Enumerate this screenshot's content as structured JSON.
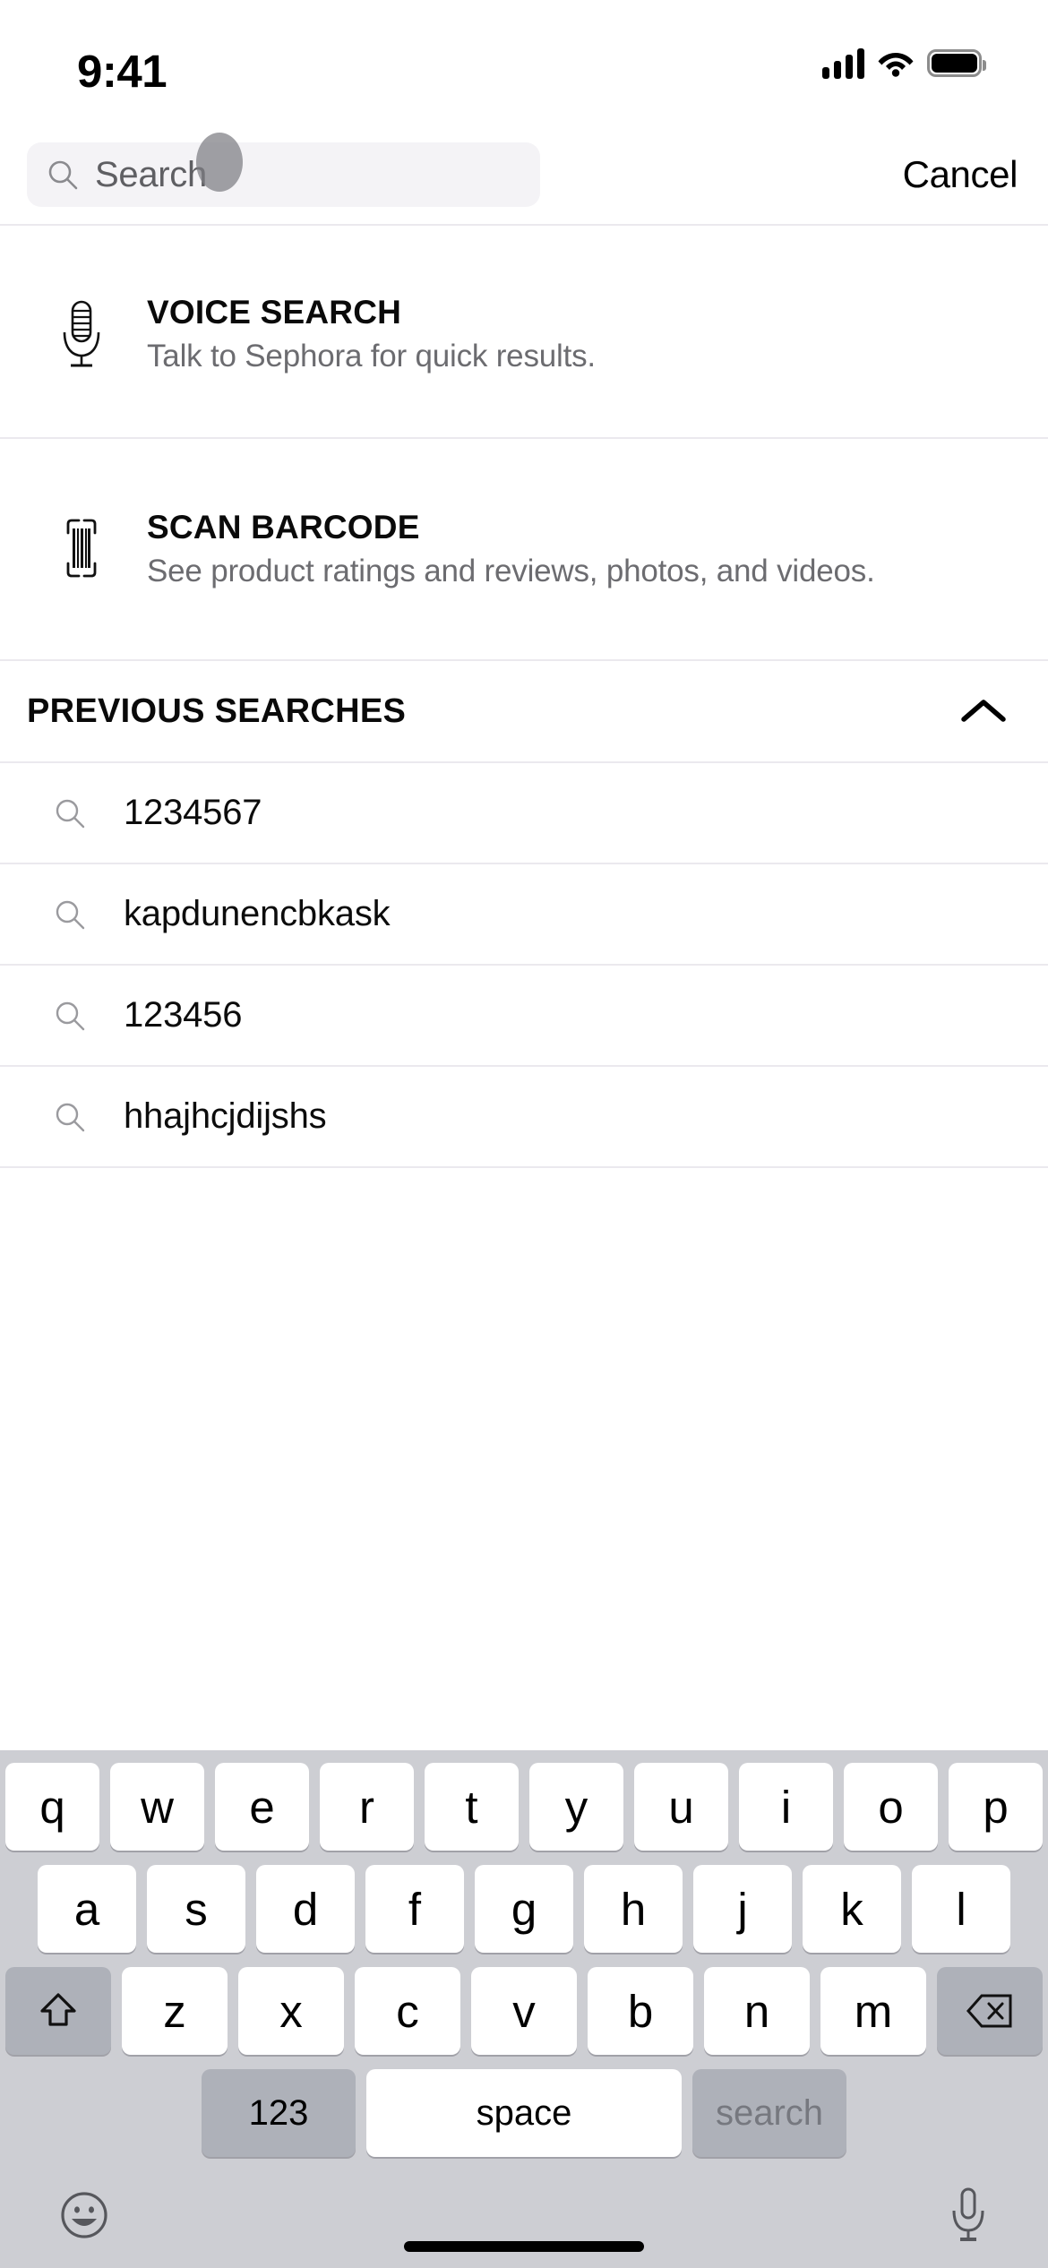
{
  "status_bar": {
    "time": "9:41",
    "signal_icon": "cellular-signal-icon",
    "wifi_icon": "wifi-icon",
    "battery_icon": "battery-icon"
  },
  "search": {
    "placeholder": "Search",
    "value": "",
    "search_icon": "search-icon",
    "cancel_label": "Cancel",
    "touch_indicator": "touch-point-overlay"
  },
  "actions": [
    {
      "id": "voice-search",
      "icon": "microphone-icon",
      "title": "VOICE SEARCH",
      "subtitle": "Talk to Sephora for quick results."
    },
    {
      "id": "scan-barcode",
      "icon": "barcode-icon",
      "title": "SCAN BARCODE",
      "subtitle": "See product ratings and reviews, photos, and videos."
    }
  ],
  "previous_searches": {
    "title": "PREVIOUS SEARCHES",
    "collapse_icon": "chevron-up-icon",
    "items": [
      {
        "label": "1234567",
        "icon": "search-icon"
      },
      {
        "label": "kapdunencbkask",
        "icon": "search-icon"
      },
      {
        "label": "123456",
        "icon": "search-icon"
      },
      {
        "label": "hhajhcjdijshs",
        "icon": "search-icon"
      }
    ]
  },
  "keyboard": {
    "row1": [
      "q",
      "w",
      "e",
      "r",
      "t",
      "y",
      "u",
      "i",
      "o",
      "p"
    ],
    "row2": [
      "a",
      "s",
      "d",
      "f",
      "g",
      "h",
      "j",
      "k",
      "l"
    ],
    "row3": [
      "z",
      "x",
      "c",
      "v",
      "b",
      "n",
      "m"
    ],
    "shift_icon": "shift-arrow-icon",
    "delete_icon": "backspace-icon",
    "numeric_label": "123",
    "space_label": "space",
    "return_label": "search",
    "emoji_icon": "emoji-smiley-icon",
    "dictation_icon": "microphone-icon"
  },
  "colors": {
    "keyboard_background": "#cdced3",
    "key_light": "#ffffff",
    "key_dark": "#aeb1b9",
    "search_field": "#f4f3f6",
    "divider": "#ebe9ee",
    "subtitle_text": "#6c6c70",
    "return_key_text": "#76787f"
  }
}
